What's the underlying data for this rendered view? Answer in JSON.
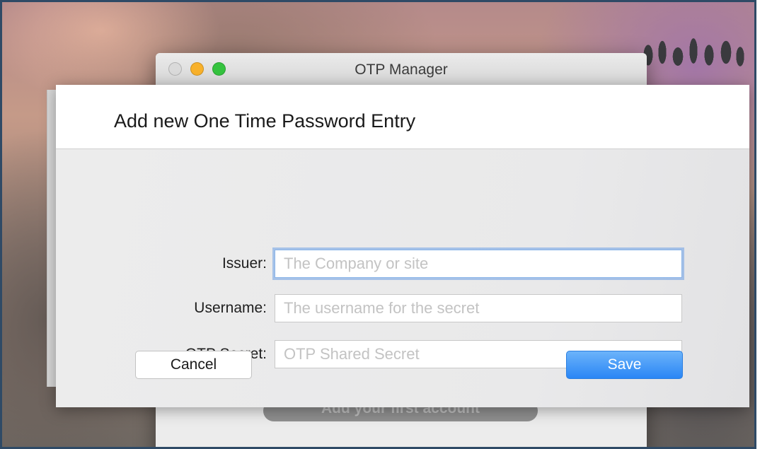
{
  "main_window": {
    "title": "OTP Manager",
    "background_button_label": "Add your first account"
  },
  "sheet": {
    "title": "Add new One Time Password Entry",
    "fields": [
      {
        "label": "Issuer:",
        "placeholder": "The Company or site",
        "value": ""
      },
      {
        "label": "Username:",
        "placeholder": "The username for the secret",
        "value": ""
      },
      {
        "label": "OTP Secret:",
        "placeholder": "OTP Shared Secret",
        "value": ""
      }
    ],
    "cancel_label": "Cancel",
    "save_label": "Save"
  },
  "colors": {
    "accent_blue": "#2a86f5",
    "focus_ring": "#8ab4e8",
    "minimize_yellow": "#f8b12b",
    "zoom_green": "#35c33f"
  }
}
